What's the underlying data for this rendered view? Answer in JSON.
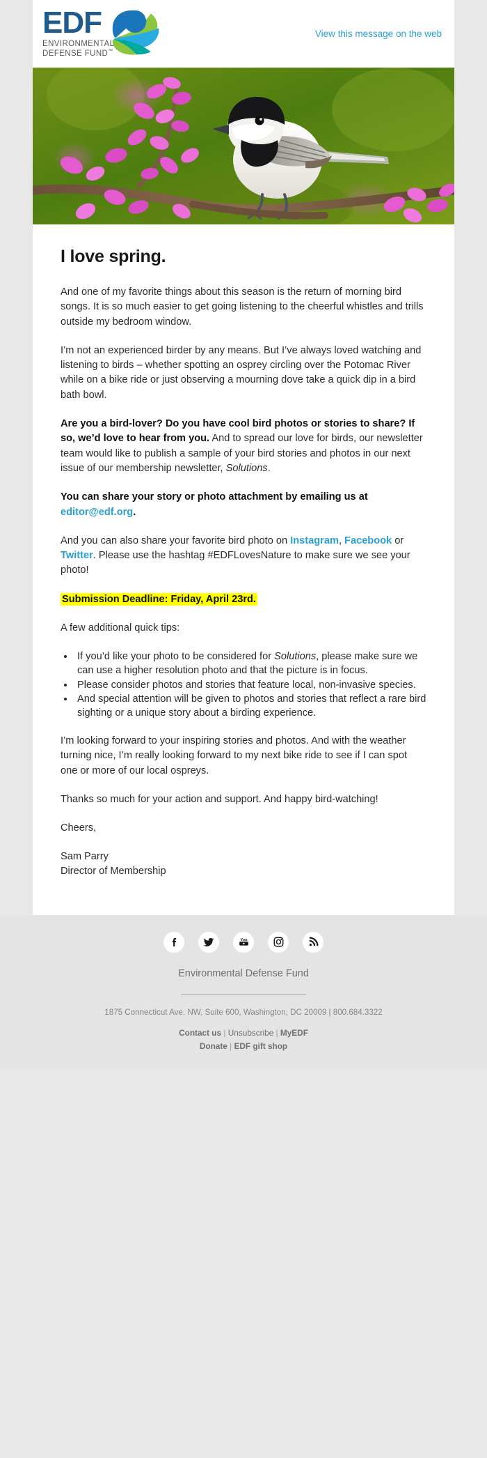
{
  "header": {
    "logo_main": "EDF",
    "logo_sub_line1": "ENVIRONMENTAL",
    "logo_sub_line2": "DEFENSE FUND",
    "logo_tm": "™",
    "view_web_label": "View this message on the web",
    "brand_blue": "#1f5b8f",
    "link_blue": "#2a9fd8"
  },
  "hero": {
    "alt": "Black-capped chickadee perched on a redbud branch in bloom"
  },
  "content": {
    "headline": "I love spring.",
    "para1": "And one of my favorite things about this season is the return of morning bird songs. It is so much easier to get going listening to the cheerful whistles and trills outside my bedroom window.",
    "para2": "I’m not an experienced birder by any means. But I’ve always loved watching and listening to birds – whether spotting an osprey circling over the Potomac River while on a bike ride or just observing a mourning dove take a quick dip in a bird bath bowl.",
    "para3_bold": "Are you a bird-lover? Do you have cool bird photos or stories to share? If so, we’d love to hear from you.",
    "para3_rest_a": " And to spread our love for birds, our newsletter team would like to publish a sample of your bird stories and photos in our next issue of our membership newsletter, ",
    "para3_italic": "Solutions",
    "para3_rest_b": ".",
    "para4_bold_a": "You can share your story or photo attachment by emailing us at ",
    "para4_email": "editor@edf.org",
    "para4_bold_b": ".",
    "para5_a": "And you can also share your favorite bird photo on ",
    "para5_instagram": "Instagram",
    "para5_b": ", ",
    "para5_facebook": "Facebook",
    "para5_c": " or ",
    "para5_twitter": "Twitter",
    "para5_d": ". Please use the hashtag #EDFLovesNature to make sure we see your photo!",
    "deadline": "Submission Deadline: Friday, April 23rd.",
    "tips_intro": "A few additional quick tips:",
    "tips": [
      {
        "pre": "If you’d like your photo to be considered for ",
        "italic": "Solutions",
        "post": ", please make sure we can use a higher resolution photo and that the picture is in focus."
      },
      {
        "pre": "Please consider photos and stories that feature local, non-invasive species.",
        "italic": "",
        "post": ""
      },
      {
        "pre": "And special attention will be given to photos and stories that reflect a rare bird sighting or a unique story about a birding experience.",
        "italic": "",
        "post": ""
      }
    ],
    "para6": "I’m looking forward to your inspiring stories and photos. And with the weather turning nice, I’m really looking forward to my next bike ride to see if I can spot one or more of our local ospreys.",
    "para7": "Thanks so much for your action and support. And happy bird-watching!",
    "signoff": "Cheers,",
    "sig_name": "Sam Parry",
    "sig_title": "Director of Membership",
    "highlight_color": "#ffff00"
  },
  "footer": {
    "social": [
      {
        "name": "facebook",
        "label": "Facebook"
      },
      {
        "name": "twitter",
        "label": "Twitter"
      },
      {
        "name": "youtube",
        "label": "YouTube"
      },
      {
        "name": "instagram",
        "label": "Instagram"
      },
      {
        "name": "rss",
        "label": "RSS"
      }
    ],
    "org_name": "Environmental Defense Fund",
    "address": "1875 Connecticut Ave. NW, Suite 600, Washington, DC 20009 | 800.684.3322",
    "links_row1": [
      {
        "label": "Contact us",
        "bold": true
      },
      {
        "label": "Unsubscribe",
        "bold": false
      },
      {
        "label": "MyEDF",
        "bold": true
      }
    ],
    "links_row2": [
      {
        "label": "Donate",
        "bold": true
      },
      {
        "label": "EDF gift shop",
        "bold": true
      }
    ],
    "separator": "|"
  }
}
